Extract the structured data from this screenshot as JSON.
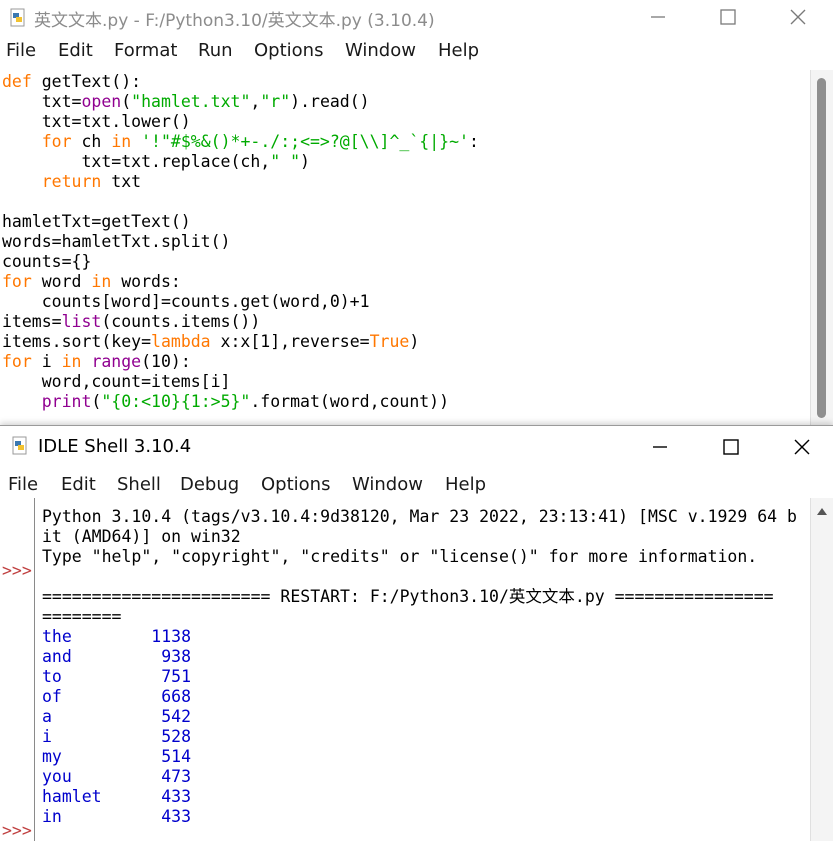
{
  "editor": {
    "title": "英文文本.py - F:/Python3.10/英文文本.py (3.10.4)",
    "menu": [
      "File",
      "Edit",
      "Format",
      "Run",
      "Options",
      "Window",
      "Help"
    ],
    "code": {
      "l1_def": "def",
      "l1_name": " getText():",
      "l2_a": "    txt=",
      "l2_b": "open",
      "l2_c": "(",
      "l2_d": "\"hamlet.txt\"",
      "l2_e": ",",
      "l2_f": "\"r\"",
      "l2_g": ").read()",
      "l3": "    txt=txt.lower()",
      "l4_a": "    ",
      "l4_b": "for",
      "l4_c": " ch ",
      "l4_d": "in",
      "l4_e": " ",
      "l4_f": "'!\"#$%&()*+-./:;<=>?@[\\\\]^_`{|}~'",
      "l4_g": ":",
      "l5_a": "        txt=txt.replace(ch,",
      "l5_b": "\" \"",
      "l5_c": ")",
      "l6_a": "    ",
      "l6_b": "return",
      "l6_c": " txt",
      "l7": "",
      "l8": "hamletTxt=getText()",
      "l9": "words=hamletTxt.split()",
      "l10": "counts={}",
      "l11_a": "for",
      "l11_b": " word ",
      "l11_c": "in",
      "l11_d": " words:",
      "l12": "    counts[word]=counts.get(word,0)+1",
      "l13_a": "items=",
      "l13_b": "list",
      "l13_c": "(counts.items())",
      "l14_a": "items.sort(key=",
      "l14_b": "lambda",
      "l14_c": " x:x[1],reverse=",
      "l14_d": "True",
      "l14_e": ")",
      "l15_a": "for",
      "l15_b": " i ",
      "l15_c": "in",
      "l15_d": " ",
      "l15_e": "range",
      "l15_f": "(10):",
      "l16": "    word,count=items[i]",
      "l17_a": "    ",
      "l17_b": "print",
      "l17_c": "(",
      "l17_d": "\"{0:<10}{1:>5}\"",
      "l17_e": ".format(word,count))"
    }
  },
  "shell": {
    "title": "IDLE Shell 3.10.4",
    "menu": [
      "File",
      "Edit",
      "Shell",
      "Debug",
      "Options",
      "Window",
      "Help"
    ],
    "prompt": ">>>",
    "banner1": "Python 3.10.4 (tags/v3.10.4:9d38120, Mar 23 2022, 23:13:41) [MSC v.1929 64 b",
    "banner2": "it (AMD64)] on win32",
    "banner3": "Type \"help\", \"copyright\", \"credits\" or \"license()\" for more information.",
    "restart1": "======================= RESTART: F:/Python3.10/英文文本.py ================",
    "restart2": "========",
    "output": [
      "the        1138",
      "and         938",
      "to          751",
      "of          668",
      "a           542",
      "i           528",
      "my          514",
      "you         473",
      "hamlet      433",
      "in          433"
    ]
  }
}
